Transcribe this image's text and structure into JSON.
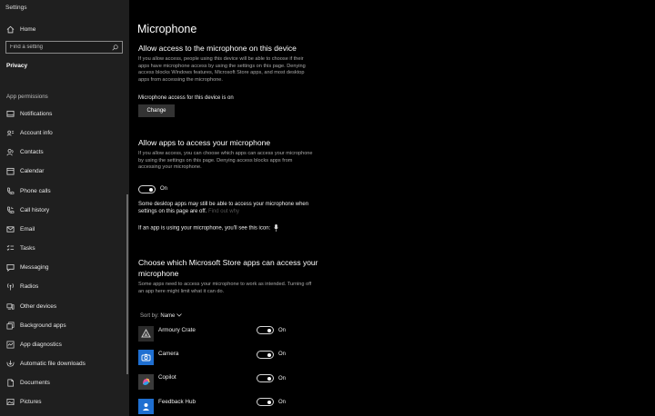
{
  "window": {
    "title": "Settings"
  },
  "sidebar": {
    "home": "Home",
    "search_placeholder": "Find a setting",
    "category": "Privacy",
    "section": "App permissions",
    "items": [
      {
        "label": "Notifications",
        "icon": "notifications-icon"
      },
      {
        "label": "Account info",
        "icon": "account-info-icon"
      },
      {
        "label": "Contacts",
        "icon": "contacts-icon"
      },
      {
        "label": "Calendar",
        "icon": "calendar-icon"
      },
      {
        "label": "Phone calls",
        "icon": "phone-icon"
      },
      {
        "label": "Call history",
        "icon": "call-history-icon"
      },
      {
        "label": "Email",
        "icon": "email-icon"
      },
      {
        "label": "Tasks",
        "icon": "tasks-icon"
      },
      {
        "label": "Messaging",
        "icon": "messaging-icon"
      },
      {
        "label": "Radios",
        "icon": "radios-icon"
      },
      {
        "label": "Other devices",
        "icon": "other-devices-icon"
      },
      {
        "label": "Background apps",
        "icon": "background-apps-icon"
      },
      {
        "label": "App diagnostics",
        "icon": "app-diagnostics-icon"
      },
      {
        "label": "Automatic file downloads",
        "icon": "file-downloads-icon"
      },
      {
        "label": "Documents",
        "icon": "documents-icon"
      },
      {
        "label": "Pictures",
        "icon": "pictures-icon"
      }
    ]
  },
  "main": {
    "title": "Microphone",
    "device_access": {
      "heading": "Allow access to the microphone on this device",
      "description": "If you allow access, people using this device will be able to choose if their apps have microphone access by using the settings on this page. Denying access blocks Windows features, Microsoft Store apps, and most desktop apps from accessing the microphone.",
      "status": "Microphone access for this device is on",
      "button": "Change"
    },
    "app_access": {
      "heading": "Allow apps to access your microphone",
      "description": "If you allow access, you can choose which apps can access your microphone by using the settings on this page. Denying access blocks apps from accessing your microphone.",
      "toggle_state": "On",
      "desktop_note": "Some desktop apps may still be able to access your microphone when settings on this page are off.",
      "find_out_why": "Find out why",
      "in_use_note": "If an app is using your microphone, you'll see this icon:"
    },
    "store_apps": {
      "heading": "Choose which Microsoft Store apps can access your microphone",
      "description": "Some apps need to access your microphone to work as intended. Turning off an app here might limit what it can do.",
      "sort_label": "Sort by:",
      "sort_value": "Name",
      "apps": [
        {
          "name": "Armoury Crate",
          "state": "On",
          "color": "#2b2b2b"
        },
        {
          "name": "Camera",
          "state": "On",
          "color": "#1f6fd1"
        },
        {
          "name": "Copilot",
          "state": "On",
          "color": "#3a3a3a"
        },
        {
          "name": "Feedback Hub",
          "state": "On",
          "color": "#1f6fd1"
        }
      ]
    }
  }
}
